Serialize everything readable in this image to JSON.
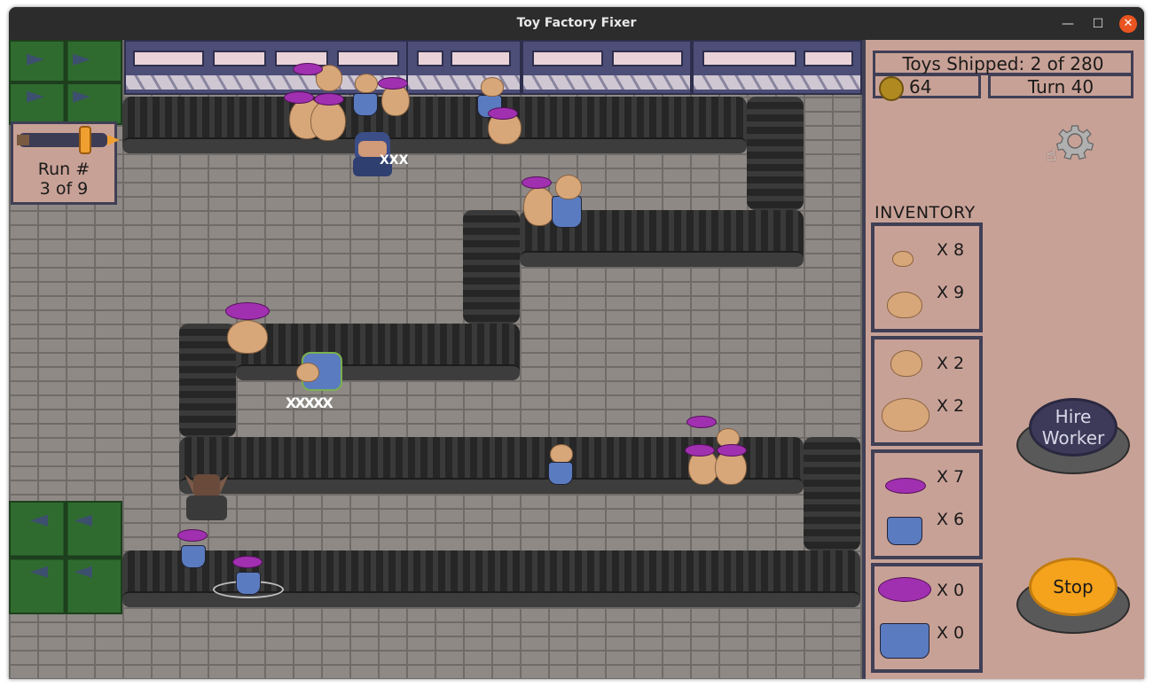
{
  "window": {
    "title": "Toy Factory Fixer",
    "minimize_glyph": "—",
    "maximize_glyph": "☐",
    "close_glyph": "✕"
  },
  "run": {
    "label": "Run #",
    "progress": "3 of 9",
    "fraction": 0.33
  },
  "hud": {
    "toys_shipped": "Toys Shipped: 2 of 280",
    "coins": "64",
    "turn": "Turn 40"
  },
  "inventory": {
    "title": "INVENTORY",
    "groups": [
      {
        "items": [
          {
            "icon": "small-bear-head-icon",
            "count": "X 8"
          },
          {
            "icon": "small-bear-body-icon",
            "count": "X 9"
          }
        ]
      },
      {
        "items": [
          {
            "icon": "bear-head-icon",
            "count": "X 2"
          },
          {
            "icon": "bear-body-icon",
            "count": "X 2"
          }
        ]
      },
      {
        "items": [
          {
            "icon": "doll-head-icon",
            "count": "X 7"
          },
          {
            "icon": "doll-body-icon",
            "count": "X 6"
          }
        ]
      },
      {
        "items": [
          {
            "icon": "doll-head-large-icon",
            "count": "X 0"
          },
          {
            "icon": "doll-body-large-icon",
            "count": "X 0"
          }
        ]
      }
    ]
  },
  "buttons": {
    "hire_line1": "Hire",
    "hire_line2": "Worker",
    "stop": "Stop"
  },
  "colors": {
    "panel": "#c8a196",
    "panel_border": "#3f3f55",
    "belt": "#2b2b2b",
    "crate": "#2f6b2f",
    "stop_button": "#f5a21c",
    "hire_button": "#3c3a58"
  }
}
